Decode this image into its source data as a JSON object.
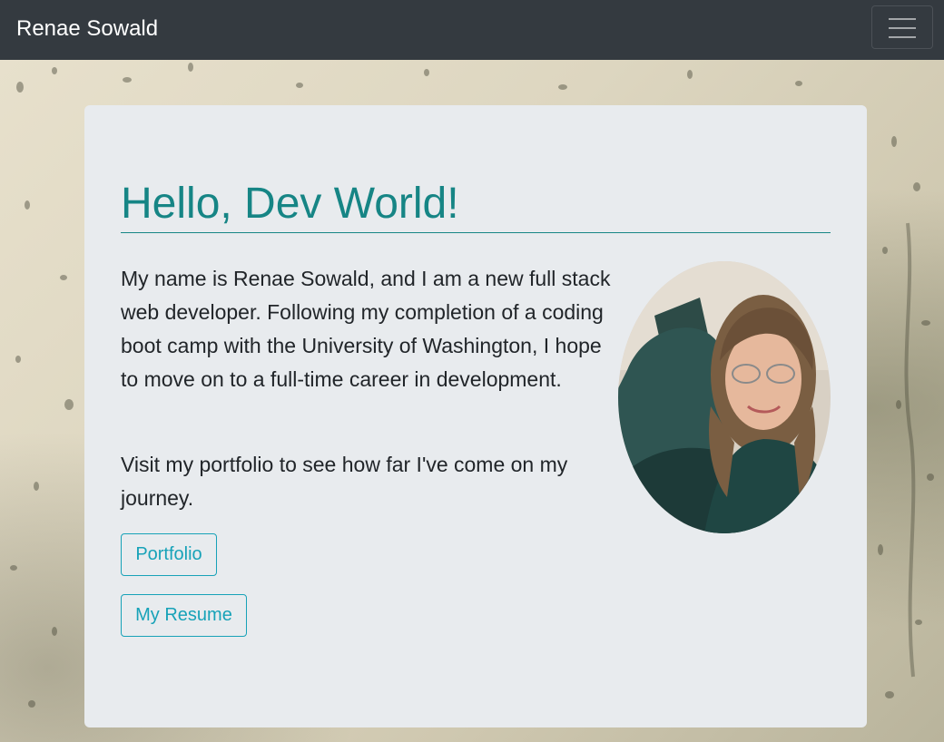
{
  "navbar": {
    "brand": "Renae Sowald",
    "toggler_icon": "hamburger-menu-icon"
  },
  "jumbotron": {
    "title": "Hello, Dev World!",
    "intro": "My name is Renae Sowald, and I am a new full stack web developer. Following my completion of a coding boot camp with the University of Washington, I hope to move on to a full-time career in development.",
    "visit": "Visit my portfolio to see how far I've come on my journey.",
    "portfolio_button": "Portfolio",
    "resume_button": "My Resume"
  },
  "colors": {
    "navbar_bg": "#343a40",
    "title": "#168585",
    "button_outline": "#17a2b8",
    "card_bg": "#e8ebee"
  }
}
